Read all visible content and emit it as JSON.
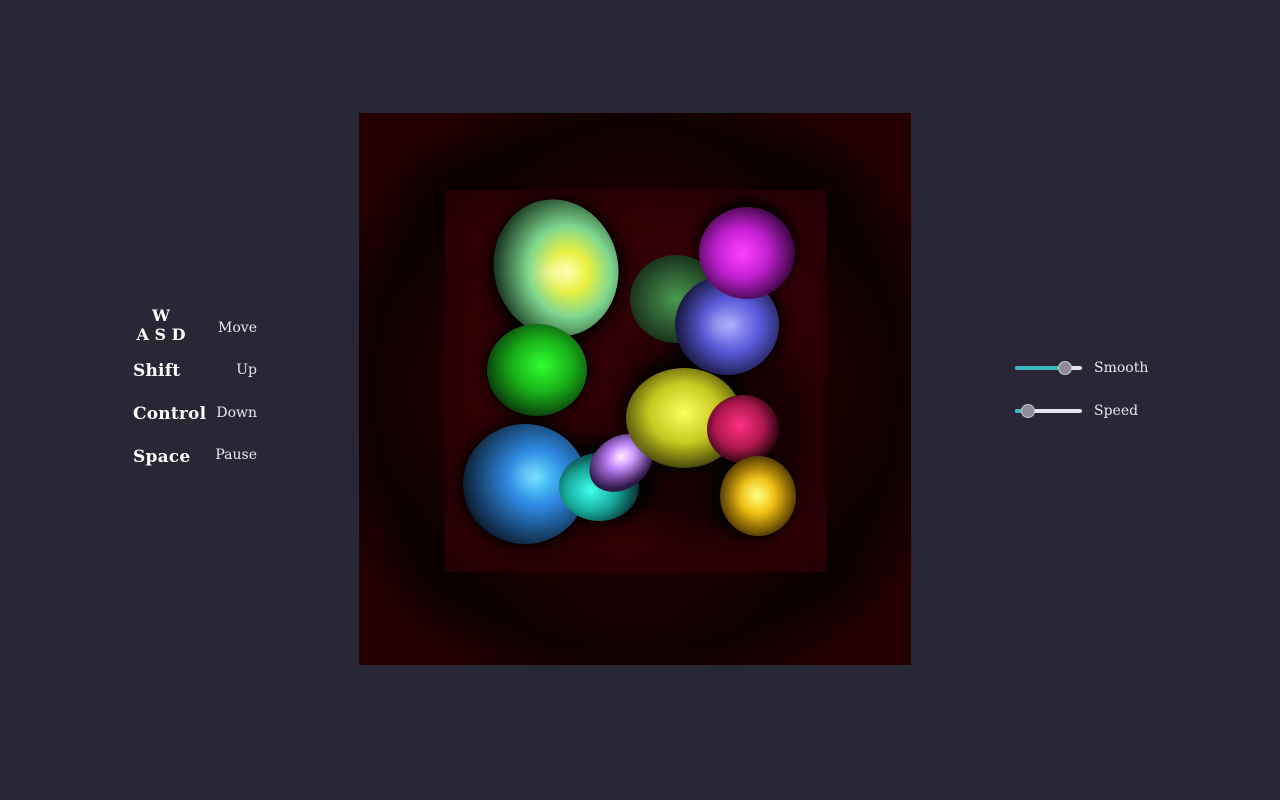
{
  "controls": {
    "move": {
      "key_top": "W",
      "key_bottom": "A S D",
      "action": "Move"
    },
    "up": {
      "key": "Shift",
      "action": "Up"
    },
    "down": {
      "key": "Control",
      "action": "Down"
    },
    "pause": {
      "key": "Space",
      "action": "Pause"
    }
  },
  "sliders": {
    "smooth": {
      "label": "Smooth",
      "value": 0.75
    },
    "speed": {
      "label": "Speed",
      "value": 0.2
    }
  },
  "colors": {
    "background": "#282735",
    "canvas": "#230002",
    "slider_fill": "#3fb6bd",
    "slider_track": "#e6e6ea",
    "slider_thumb": "#8d8d96"
  },
  "metaballs": [
    {
      "color": "#b8ff66",
      "name": "mint-yellow"
    },
    {
      "color": "#2cff2c",
      "name": "green"
    },
    {
      "color": "#3fb4ff",
      "name": "blue"
    },
    {
      "color": "#44f3e0",
      "name": "cyan"
    },
    {
      "color": "#d48cff",
      "name": "lavender"
    },
    {
      "color": "#f7ff44",
      "name": "yellow"
    },
    {
      "color": "#ff3d9a",
      "name": "pink"
    },
    {
      "color": "#ffd21a",
      "name": "gold"
    },
    {
      "color": "#7a7aff",
      "name": "violet-blue"
    },
    {
      "color": "#ff30ff",
      "name": "magenta"
    },
    {
      "color": "#4f8f58",
      "name": "dark-green"
    }
  ]
}
